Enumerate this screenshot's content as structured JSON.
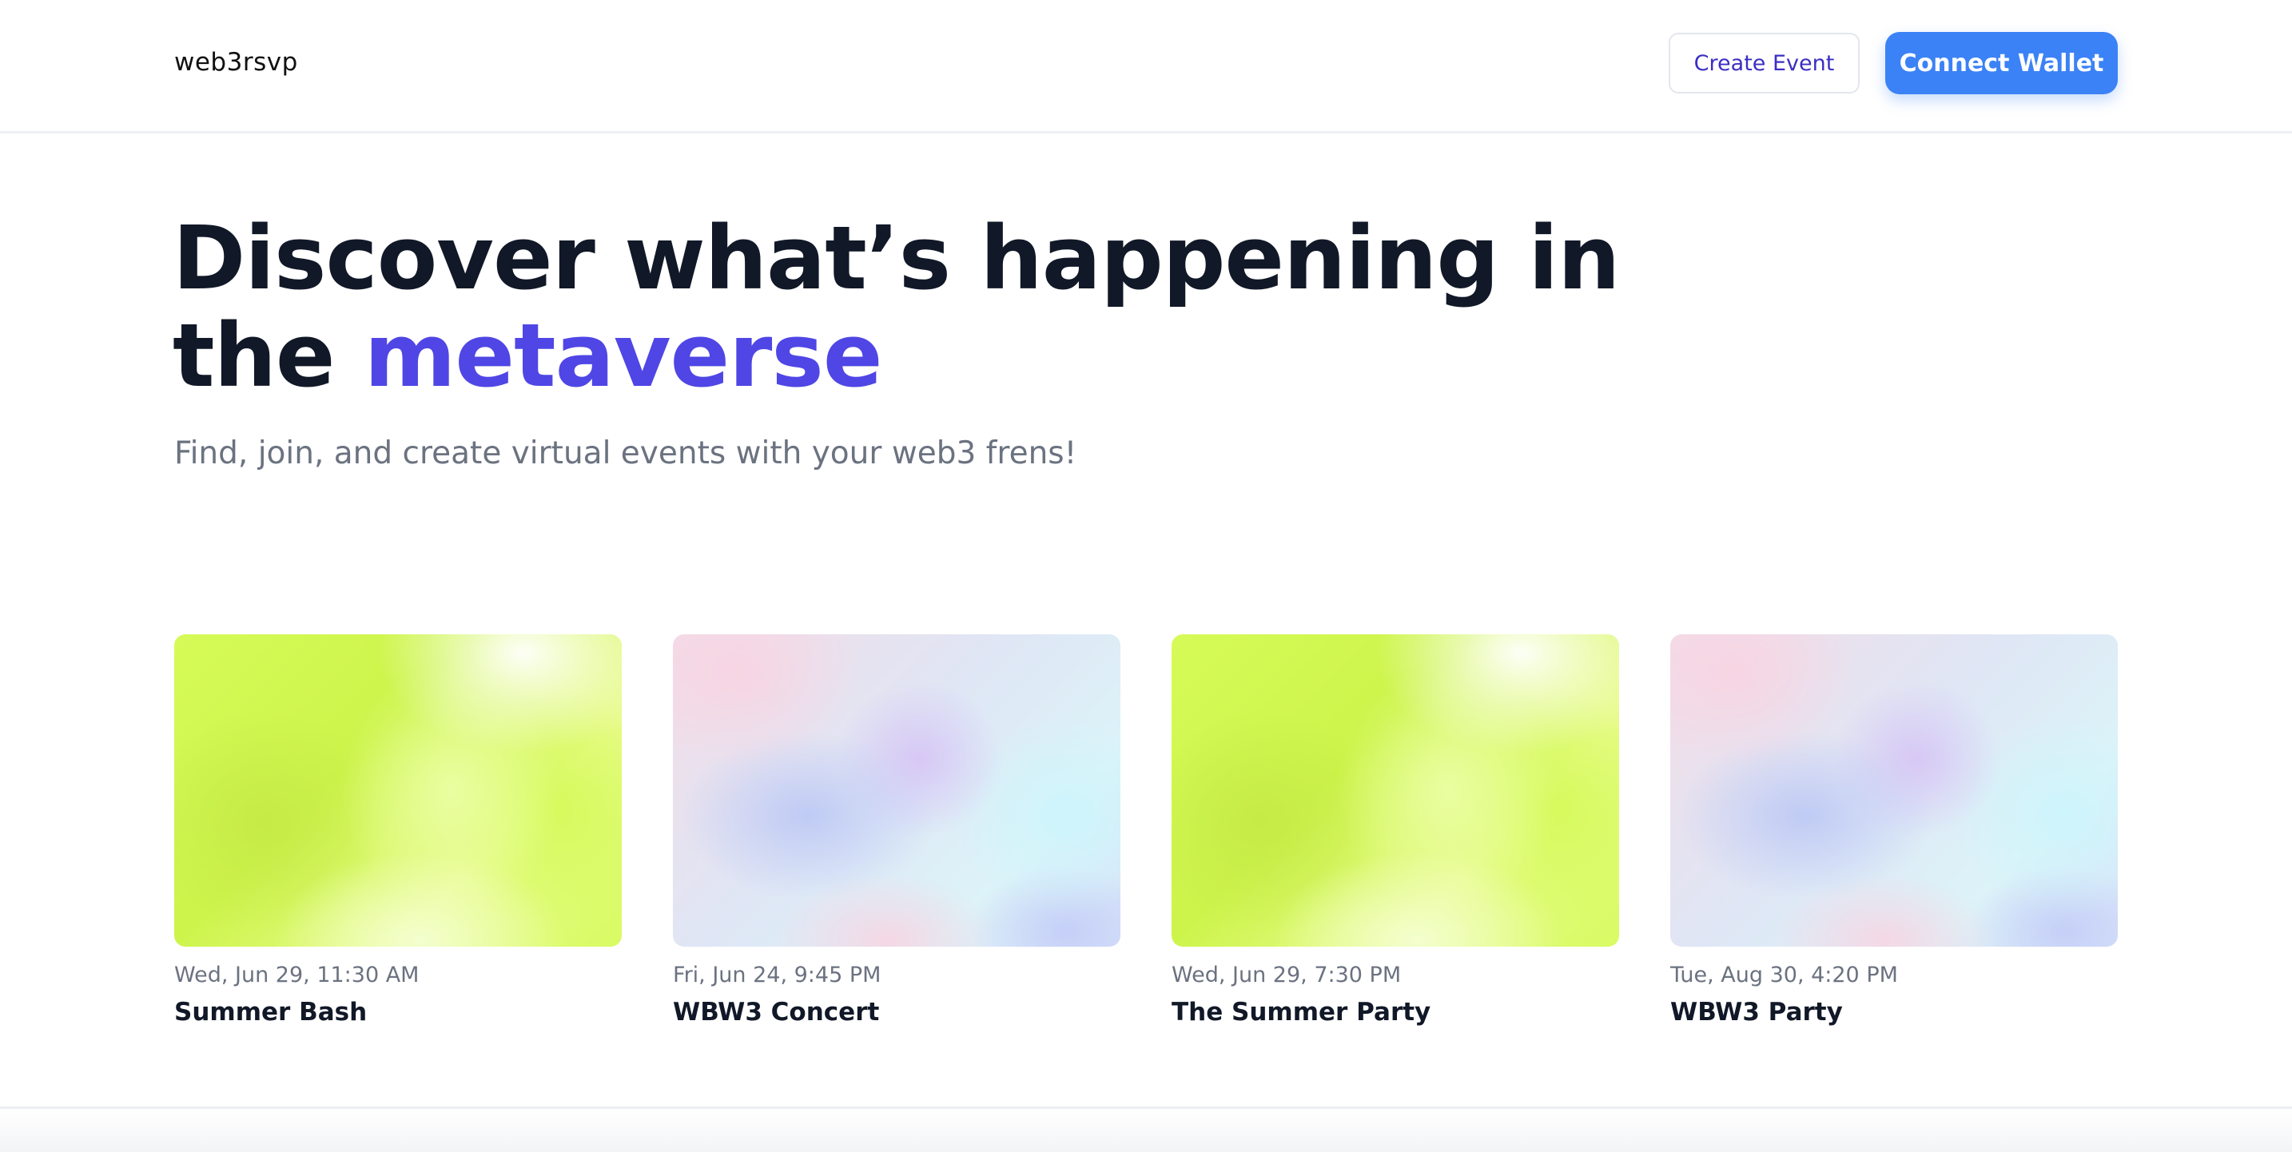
{
  "header": {
    "logo": "web3rsvp",
    "create_event_label": "Create Event",
    "connect_wallet_label": "Connect Wallet"
  },
  "hero": {
    "title_line1": "Discover what’s happening in",
    "title_line2_prefix": "the ",
    "title_accent": "metaverse",
    "subtitle": "Find, join, and create virtual events with your web3 frens!"
  },
  "events": [
    {
      "date": "Wed, Jun 29, 11:30 AM",
      "title": "Summer Bash",
      "image": "lime-gradient"
    },
    {
      "date": "Fri, Jun 24, 9:45 PM",
      "title": "WBW3 Concert",
      "image": "pastel-gradient"
    },
    {
      "date": "Wed, Jun 29, 7:30 PM",
      "title": "The Summer Party",
      "image": "lime-gradient"
    },
    {
      "date": "Tue, Aug 30, 4:20 PM",
      "title": "WBW3 Party",
      "image": "pastel-gradient"
    }
  ],
  "colors": {
    "accent": "#4f46e5",
    "primary_button": "#3b82f6",
    "create_button_text": "#3b2fc4",
    "muted_text": "#6b7280",
    "heading_text": "#111827"
  }
}
